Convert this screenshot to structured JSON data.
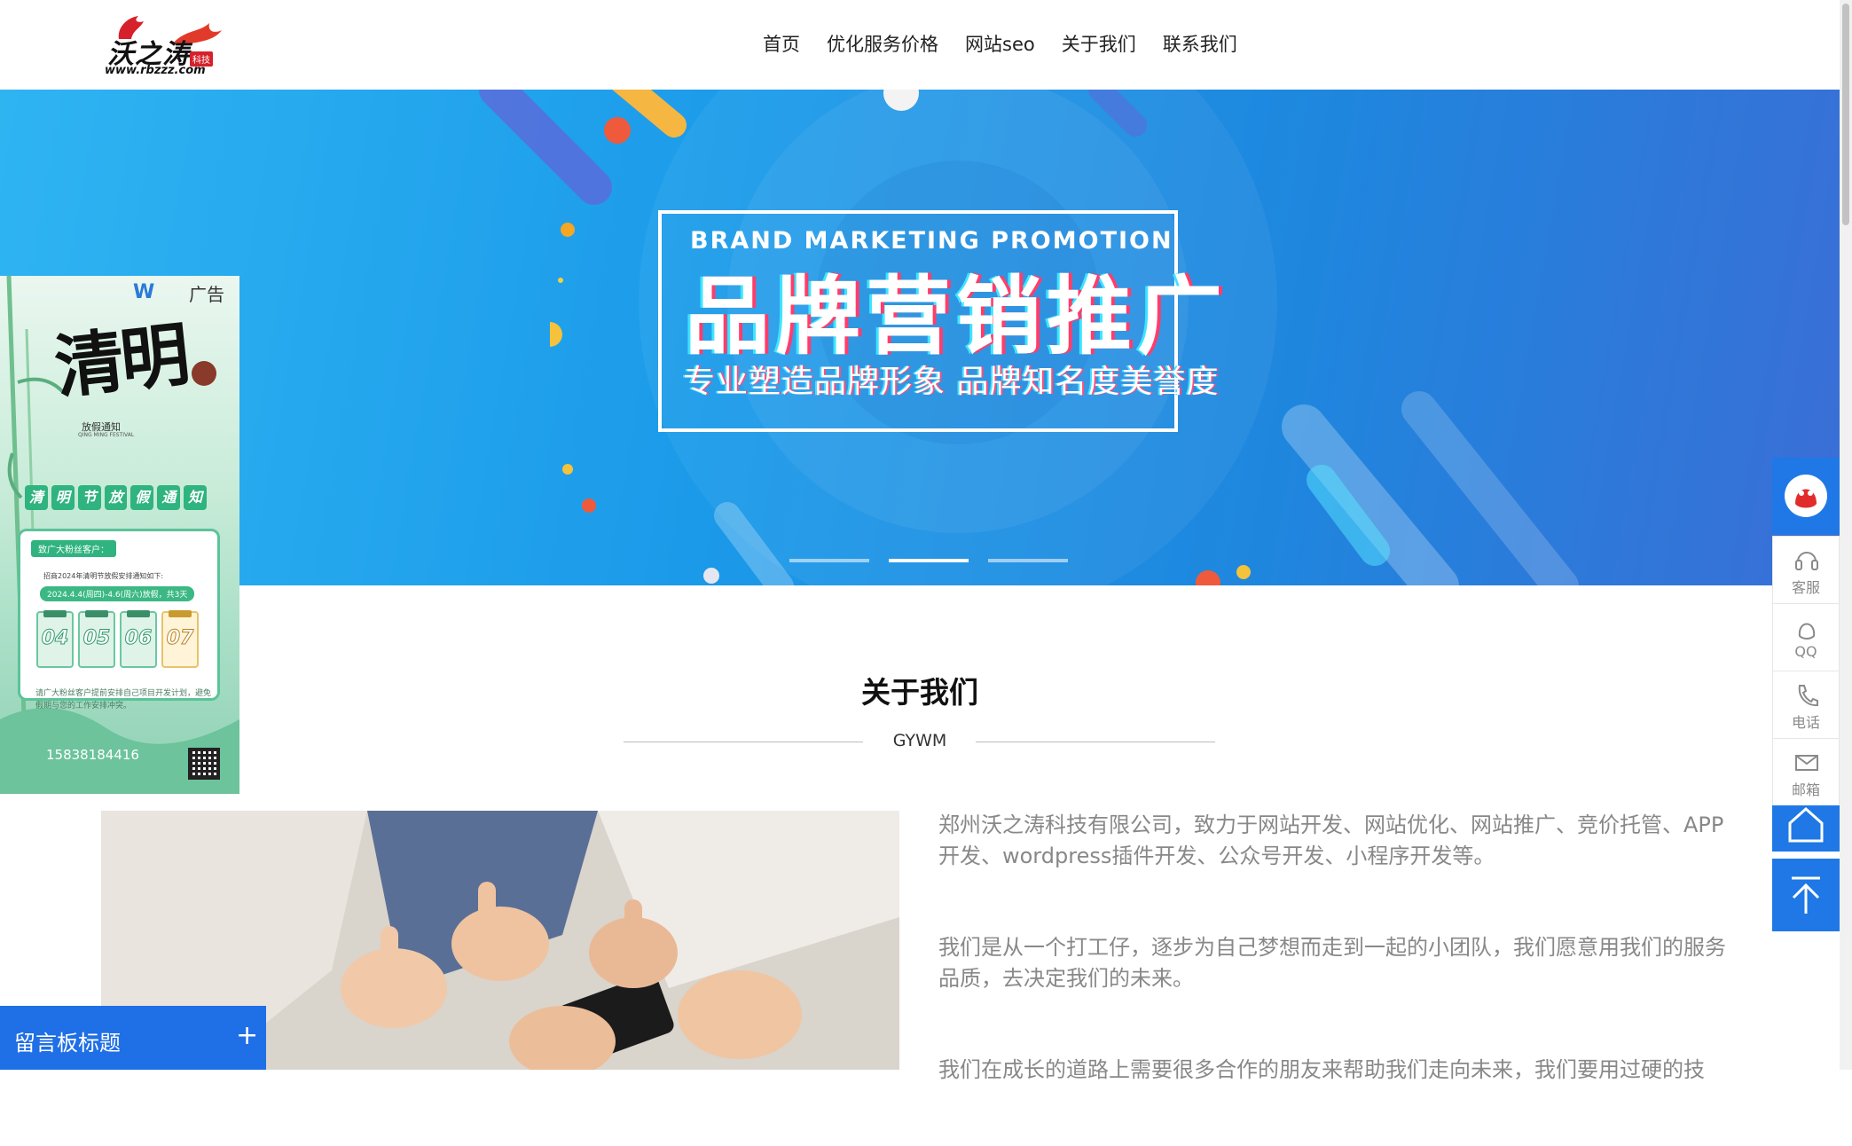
{
  "header": {
    "logo_text": "沃之涛",
    "logo_badge": "科技",
    "logo_url": "www.rbzzz.com",
    "nav": [
      "首页",
      "优化服务价格",
      "网站seo",
      "关于我们",
      "联系我们"
    ]
  },
  "banner": {
    "title_en": "BRAND MARKETING PROMOTION",
    "title_cn": "品牌营销推广",
    "subtitle": "专业塑造品牌形象  品牌知名度美誉度",
    "slides": 3,
    "active_slide": 2
  },
  "ad": {
    "label": "广告",
    "title": "清明",
    "subtitle": "放假通知",
    "subtitle_en": "QING MING FESTIVAL",
    "band": [
      "清",
      "明",
      "节",
      "放",
      "假",
      "通",
      "知"
    ],
    "card_head": "致广大粉丝客户：",
    "card_line": "招商2024年清明节放假安排通知如下:",
    "card_date": "2024.4.4(周四)-4.6(周六)放假，共3天",
    "days": [
      "04",
      "05",
      "06",
      "07"
    ],
    "note": "请广大粉丝客户提前安排自己项目开发计划，避免假期与您的工作安排冲突。",
    "phone": "15838184416"
  },
  "about": {
    "title": "关于我们",
    "subtitle": "GYWM",
    "paragraphs": [
      "郑州沃之涛科技有限公司，致力于网站开发、网站优化、网站推广、竞价托管、APP开发、wordpress插件开发、公众号开发、小程序开发等。",
      "我们是从一个打工仔，逐步为自己梦想而走到一起的小团队，我们愿意用我们的服务品质，去决定我们的未来。",
      "我们在成长的道路上需要很多合作的朋友来帮助我们走向未来，我们要用过硬的技"
    ]
  },
  "float_bar": {
    "items": [
      {
        "label": "客服",
        "icon": "headset-icon"
      },
      {
        "label": "QQ",
        "icon": "qq-icon"
      },
      {
        "label": "电话",
        "icon": "phone-icon"
      },
      {
        "label": "邮箱",
        "icon": "mail-icon"
      }
    ]
  },
  "message_board": {
    "title": "留言板标题",
    "toggle": "+"
  },
  "colors": {
    "brand_blue": "#1f78e6",
    "banner_blue": "#1b9ae9",
    "logo_red": "#d6202b"
  }
}
